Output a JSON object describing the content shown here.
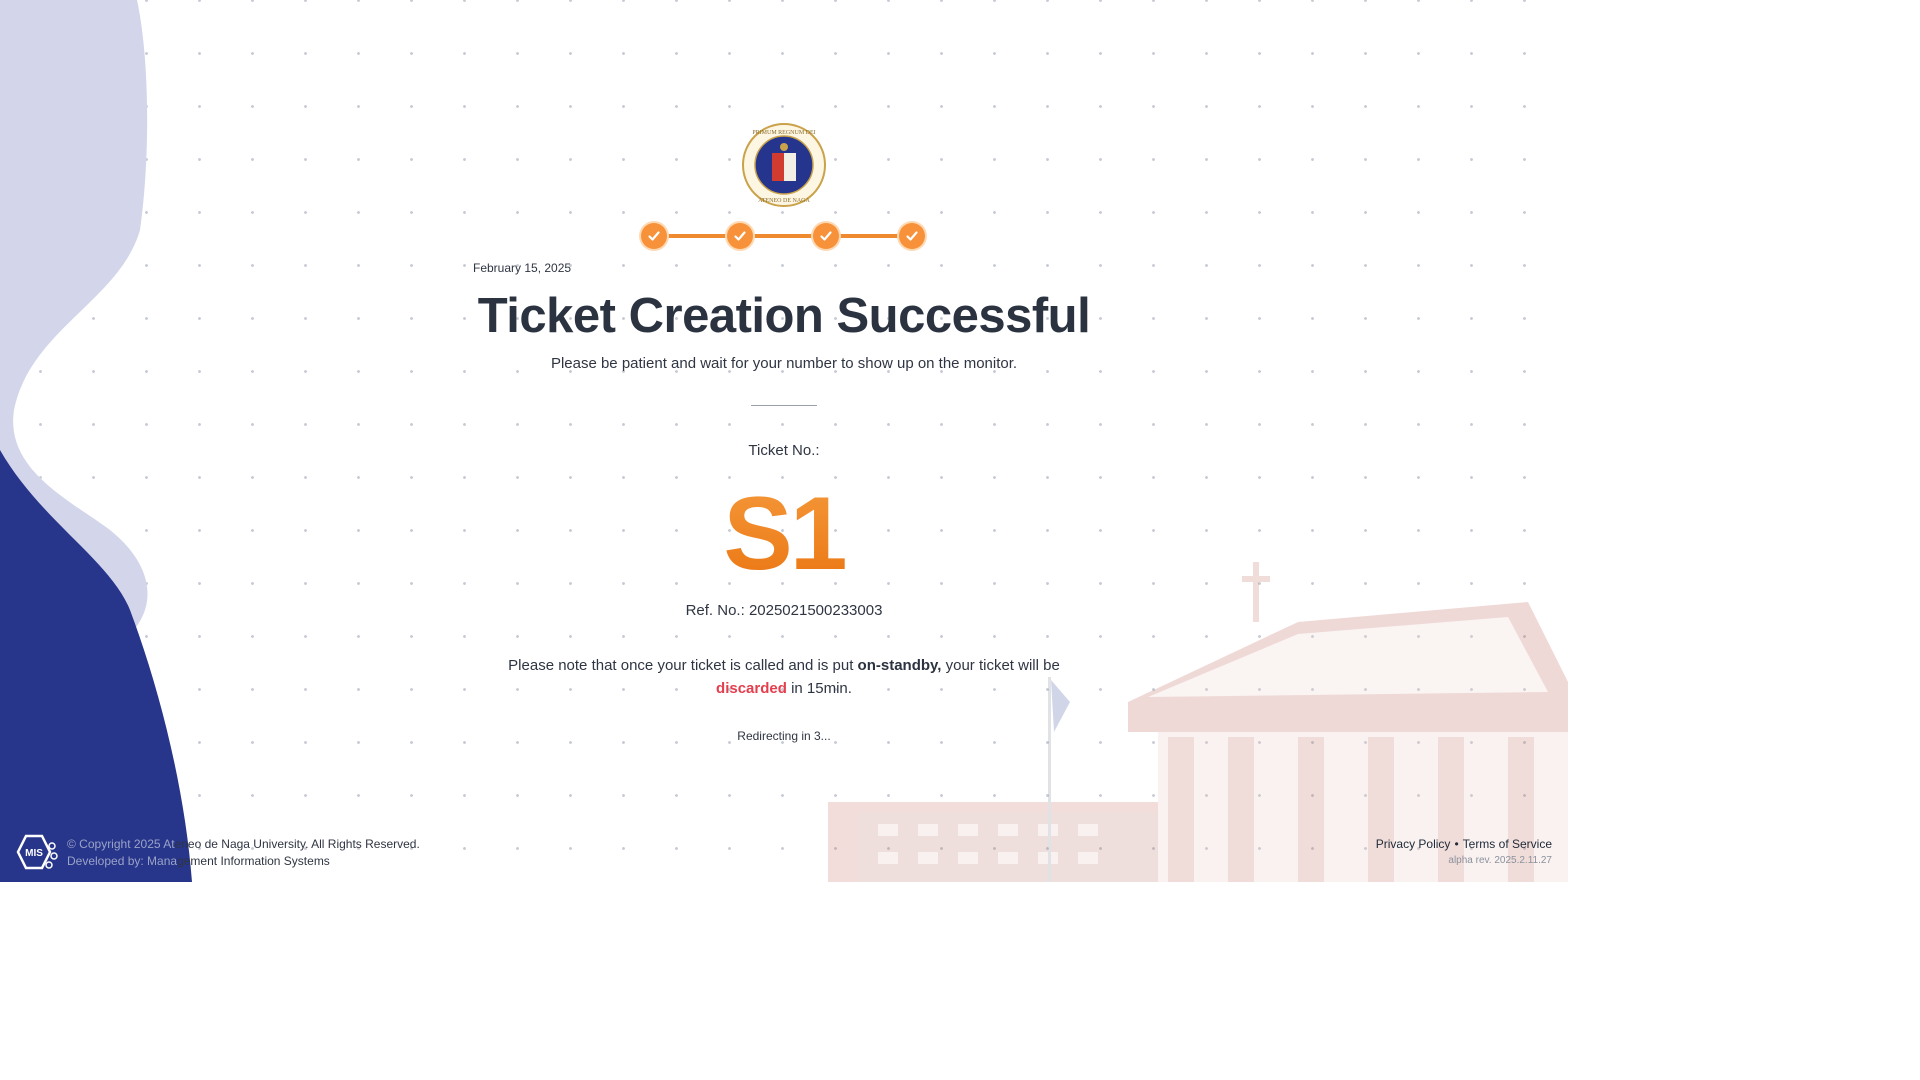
{
  "header": {
    "date": "February 15, 2025",
    "steps_completed": 4,
    "steps_total": 4
  },
  "main": {
    "title": "Ticket Creation Successful",
    "subtitle": "Please be patient and wait for your number to show up on the monitor.",
    "ticket_label": "Ticket No.:",
    "ticket_number": "S1",
    "ref_label": "Ref. No.:",
    "ref_number": "2025021500233003",
    "note_part1": "Please note that once your ticket is called and is put ",
    "note_bold": "on-standby,",
    "note_part2": " your ticket will be ",
    "note_red": "discarded",
    "note_part3": " in 15min.",
    "redirect": "Redirecting in 3..."
  },
  "footer": {
    "copyright_prefix": "© Copyright 2025 At",
    "copyright_rest": "eneo de Naga University. All Rights Reserved.",
    "developed_prefix": "Developed by: Mana",
    "developed_rest": "gement Information Systems",
    "privacy": "Privacy Policy",
    "separator": "•",
    "terms": "Terms of Service",
    "version": "alpha rev. 2025.2.11.27"
  },
  "colors": {
    "accent_orange": "#f7923a",
    "navy": "#27358a",
    "lavender": "#d3d6ea",
    "danger": "#e53e4d",
    "text": "#2f3542"
  },
  "icons": {
    "step": "check-icon",
    "seal": "ateneo-seal-icon",
    "dev_logo": "mis-logo-icon"
  }
}
